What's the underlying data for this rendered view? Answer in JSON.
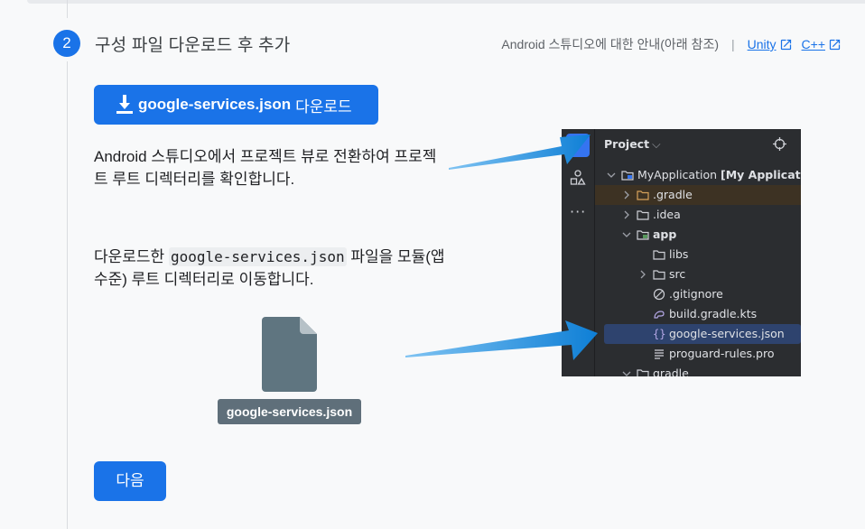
{
  "step": {
    "number": "2",
    "title": "구성 파일 다운로드 후 추가"
  },
  "guide": {
    "text": "Android 스튜디오에 대한 안내(아래 참조)",
    "separator": "|",
    "links": [
      "Unity",
      "C++"
    ]
  },
  "download_button": {
    "filename": "google-services.json",
    "suffix": "다운로드"
  },
  "instructions": {
    "para1": "Android 스튜디오에서 프로젝트 뷰로 전환하여 프로젝트 루트 디렉터리를 확인합니다.",
    "para2_prefix": "다운로드한 ",
    "para2_code": "google-services.json",
    "para2_suffix": " 파일을 모듈(앱 수준) 루트 디렉터리로 이동합니다."
  },
  "file": {
    "label": "google-services.json",
    "icon": "file-icon"
  },
  "next_button": {
    "label": "다음"
  },
  "ide": {
    "header": "Project",
    "tree": [
      {
        "label": "MyApplication",
        "suffix": "[My Application]",
        "icon": "folder-icon"
      },
      {
        "label": ".gradle",
        "icon": "folder-icon"
      },
      {
        "label": ".idea",
        "icon": "folder-icon"
      },
      {
        "label": "app",
        "icon": "module-folder-icon"
      },
      {
        "label": "libs",
        "icon": "folder-icon"
      },
      {
        "label": "src",
        "icon": "folder-icon"
      },
      {
        "label": ".gitignore",
        "icon": "gitignore-icon"
      },
      {
        "label": "build.gradle.kts",
        "icon": "gradle-script-icon"
      },
      {
        "label": "google-services.json",
        "icon": "json-icon"
      },
      {
        "label": "proguard-rules.pro",
        "icon": "text-file-icon"
      },
      {
        "label": "gradle",
        "icon": "folder-icon"
      }
    ]
  },
  "colors": {
    "primary": "#1a73e8",
    "ide_bg": "#2b2d30",
    "arrow": "#1a8fe3",
    "file_label_bg": "#5f6f7a"
  }
}
